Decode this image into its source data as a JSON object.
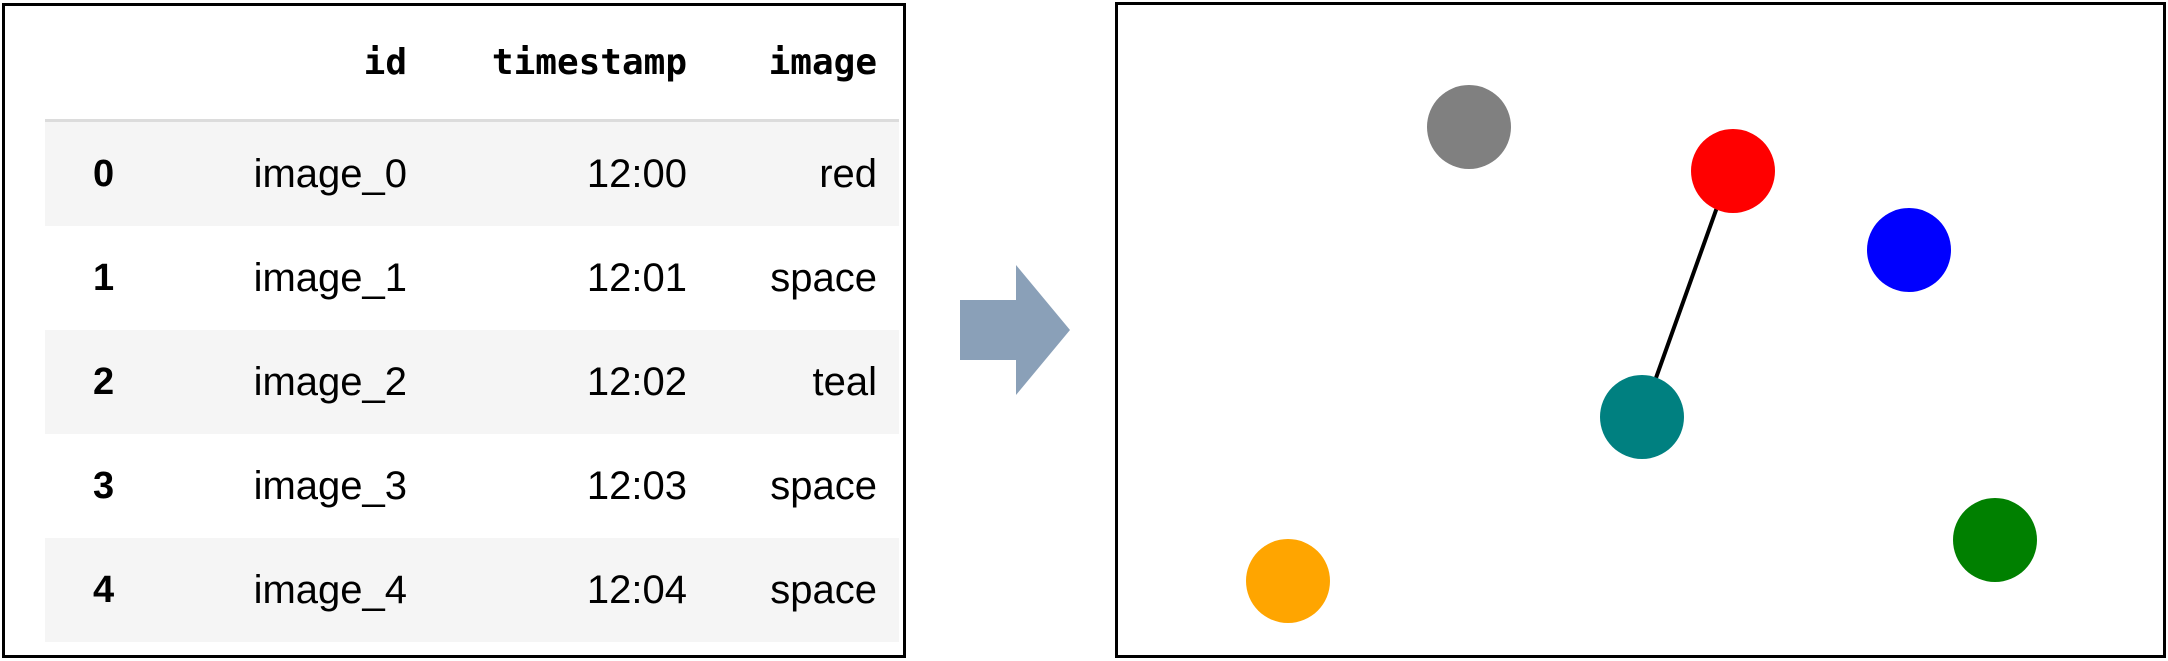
{
  "dataframe": {
    "index_header": "",
    "columns": [
      "id",
      "timestamp",
      "image"
    ],
    "rows": [
      {
        "index": "0",
        "id": "image_0",
        "timestamp": "12:00",
        "image": "red"
      },
      {
        "index": "1",
        "id": "image_1",
        "timestamp": "12:01",
        "image": "space"
      },
      {
        "index": "2",
        "id": "image_2",
        "timestamp": "12:02",
        "image": "teal"
      },
      {
        "index": "3",
        "id": "image_3",
        "timestamp": "12:03",
        "image": "space"
      },
      {
        "index": "4",
        "id": "image_4",
        "timestamp": "12:04",
        "image": "space"
      }
    ]
  },
  "arrow": {
    "icon": "right-arrow-icon",
    "color": "#8aa0b8"
  },
  "scene": {
    "dot_colors": {
      "gray": "#808080",
      "red": "#ff0000",
      "blue": "#0000ff",
      "teal": "#008080",
      "orange": "#ffa500",
      "green": "#008000"
    },
    "connector": {
      "from": "red",
      "to": "teal",
      "color": "#000000"
    }
  }
}
